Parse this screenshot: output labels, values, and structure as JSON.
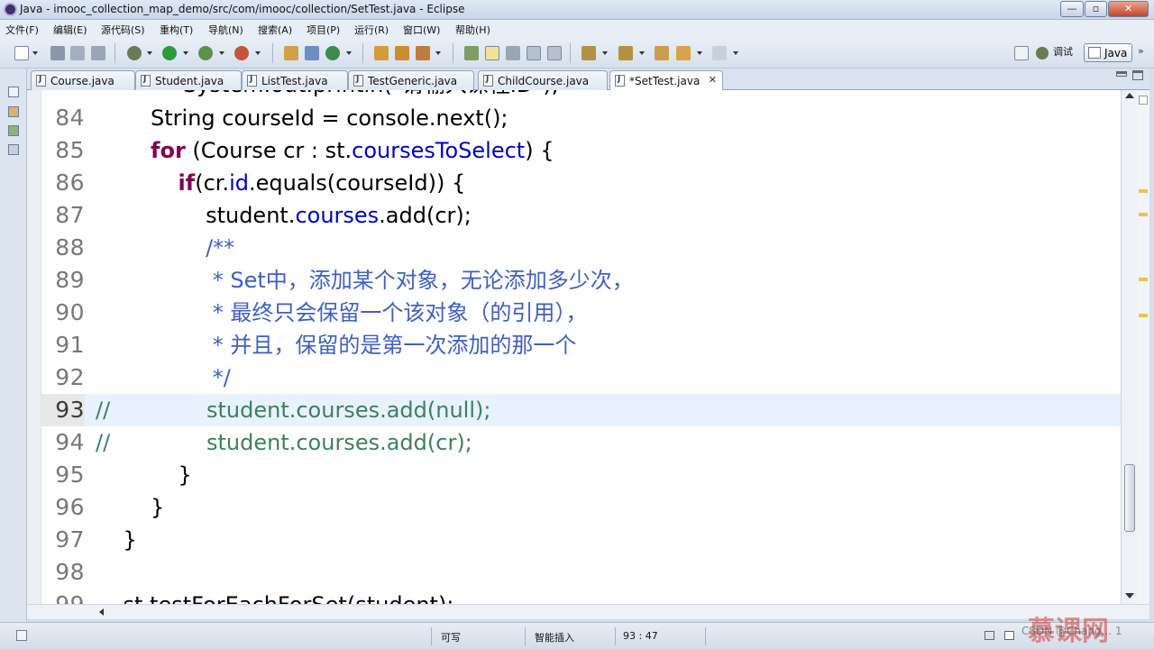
{
  "window": {
    "title": "Java - imooc_collection_map_demo/src/com/imooc/collection/SetTest.java - Eclipse",
    "btn_min": "—",
    "btn_max": "▫",
    "btn_close": "✕"
  },
  "menu": [
    "文件(F)",
    "编辑(E)",
    "源代码(S)",
    "重构(T)",
    "导航(N)",
    "搜索(A)",
    "项目(P)",
    "运行(R)",
    "窗口(W)",
    "帮助(H)"
  ],
  "perspectives": {
    "debug_label": "调试",
    "java_label": "Java"
  },
  "tabs": [
    {
      "label": "Course.java",
      "active": false
    },
    {
      "label": "Student.java",
      "active": false
    },
    {
      "label": "ListTest.java",
      "active": false
    },
    {
      "label": "TestGeneric.java",
      "active": false
    },
    {
      "label": "ChildCourse.java",
      "active": false
    },
    {
      "label": "*SetTest.java",
      "active": true
    }
  ],
  "editor": {
    "top_partial": "System.out.println(\"请输入课程ID\");",
    "lines": [
      {
        "num": "84",
        "indent": "        ",
        "parts": [
          [
            "",
            "String courseId = console.next();"
          ]
        ]
      },
      {
        "num": "85",
        "indent": "        ",
        "parts": [
          [
            "kw",
            "for"
          ],
          [
            "",
            " (Course cr : st."
          ],
          [
            "fld",
            "coursesToSelect"
          ],
          [
            "",
            ") {"
          ]
        ]
      },
      {
        "num": "86",
        "indent": "            ",
        "parts": [
          [
            "kw",
            "if"
          ],
          [
            "",
            "(cr."
          ],
          [
            "fld",
            "id"
          ],
          [
            "",
            ".equals(courseId)) {"
          ]
        ]
      },
      {
        "num": "87",
        "indent": "                ",
        "parts": [
          [
            "",
            "student."
          ],
          [
            "fld",
            "courses"
          ],
          [
            "",
            ".add(cr);"
          ]
        ]
      },
      {
        "num": "88",
        "indent": "                ",
        "parts": [
          [
            "cmt",
            "/**"
          ]
        ]
      },
      {
        "num": "89",
        "indent": "                 ",
        "parts": [
          [
            "cmt",
            "* Set中，添加某个对象，无论添加多少次，"
          ]
        ]
      },
      {
        "num": "90",
        "indent": "                 ",
        "parts": [
          [
            "cmt",
            "* 最终只会保留一个该对象（的引用），"
          ]
        ]
      },
      {
        "num": "91",
        "indent": "                 ",
        "parts": [
          [
            "cmt",
            "* 并且，保留的是第一次添加的那一个"
          ]
        ]
      },
      {
        "num": "92",
        "indent": "                 ",
        "parts": [
          [
            "cmt",
            "*/"
          ]
        ]
      },
      {
        "num": "93",
        "indent": "",
        "parts": [
          [
            "lc",
            "//              student.courses.add(null);"
          ]
        ],
        "current": true
      },
      {
        "num": "94",
        "indent": "",
        "parts": [
          [
            "lc",
            "//              student.courses.add(cr);"
          ]
        ]
      },
      {
        "num": "95",
        "indent": "            ",
        "parts": [
          [
            "",
            "}"
          ]
        ]
      },
      {
        "num": "96",
        "indent": "        ",
        "parts": [
          [
            "",
            "}"
          ]
        ]
      },
      {
        "num": "97",
        "indent": "    ",
        "parts": [
          [
            "",
            "}"
          ]
        ]
      },
      {
        "num": "98",
        "indent": "",
        "parts": [
          [
            "",
            ""
          ]
        ]
      },
      {
        "num": "99",
        "indent": "    ",
        "parts": [
          [
            "",
            "st.testForEachForSet(student);"
          ]
        ]
      }
    ]
  },
  "status": {
    "writable": "可写",
    "insert_mode": "智能插入",
    "position": "93 : 47"
  },
  "watermark": {
    "brand": "慕课网",
    "csdn": "CSDN @Chang... 1"
  }
}
